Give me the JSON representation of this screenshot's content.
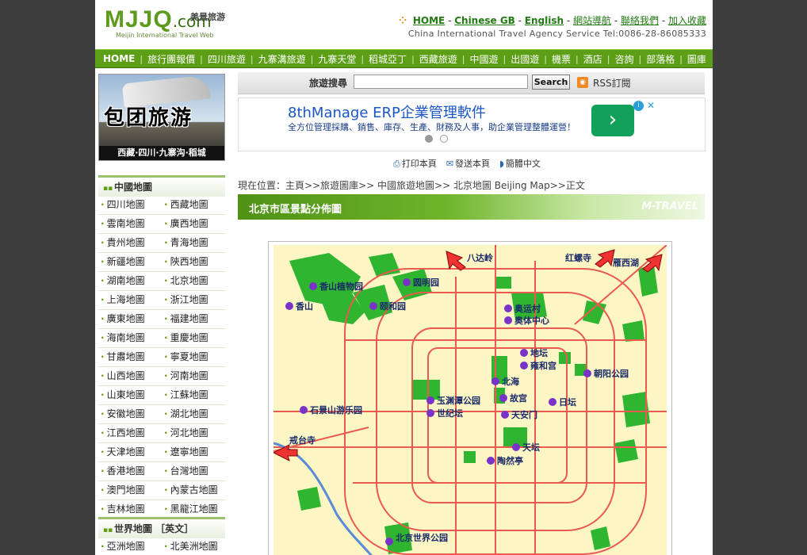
{
  "header": {
    "logo_main": "MJJQ",
    "logo_com": ".com",
    "logo_cn": "美景旅游",
    "logo_en": "Meijin International Travel Web",
    "links": [
      "HOME",
      "Chinese GB",
      "English",
      "網站導航",
      "聯絡我們",
      "加入收藏"
    ],
    "agency": "China International Travel Agency Service Tel:0086-28-86085333"
  },
  "nav": [
    "HOME",
    "旅行團報價",
    "四川旅遊",
    "九寨溝旅遊",
    "九寨天堂",
    "稻城亞丁",
    "西藏旅遊",
    "中國遊",
    "出國遊",
    "機票",
    "酒店",
    "咨詢",
    "部落格",
    "圖庫"
  ],
  "sidebar": {
    "banner_big": "包团旅游",
    "banner_small": "西藏·四川·九寨沟·稻城",
    "china_maps_heading": "中國地圖",
    "china_maps": [
      [
        "四川地圖",
        "西藏地圖"
      ],
      [
        "雲南地圖",
        "廣西地圖"
      ],
      [
        "貴州地圖",
        "青海地圖"
      ],
      [
        "新疆地圖",
        "陝西地圖"
      ],
      [
        "湖南地圖",
        "北京地圖"
      ],
      [
        "上海地圖",
        "浙江地圖"
      ],
      [
        "廣東地圖",
        "福建地圖"
      ],
      [
        "海南地圖",
        "重慶地圖"
      ],
      [
        "甘肅地圖",
        "寧夏地圖"
      ],
      [
        "山西地圖",
        "河南地圖"
      ],
      [
        "山東地圖",
        "江蘇地圖"
      ],
      [
        "安徽地圖",
        "湖北地圖"
      ],
      [
        "江西地圖",
        "河北地圖"
      ],
      [
        "天津地圖",
        "遼寧地圖"
      ],
      [
        "香港地圖",
        "台灣地圖"
      ],
      [
        "澳門地圖",
        "內蒙古地圖"
      ],
      [
        "吉林地圖",
        "黑龍江地圖"
      ]
    ],
    "world_maps_heading": "世界地圖 ［英文］",
    "world_maps": [
      [
        "亞洲地圖",
        "北美洲地圖"
      ]
    ]
  },
  "search": {
    "label": "旅遊搜尋",
    "button": "Search",
    "rss": "RSS訂閱"
  },
  "ad": {
    "title": "8thManage ERP企業管理軟件",
    "subtitle": "全方位管理採購、銷售、庫存、生產、財務及人事，助企業管理整體運營！"
  },
  "tools": {
    "print": "打印本頁",
    "send": "發送本頁",
    "convert": "簡體中文"
  },
  "breadcrumb": "現在位置：主頁>>旅遊圖庫>> 中國旅遊地圖>> 北京地圖 Beijing Map>>正文",
  "title": {
    "text": "北京市區景點分佈圖",
    "watermark": "M-TRAVEL"
  },
  "map_labels": [
    "八达岭",
    "红螺寺",
    "雁西湖",
    "香山植物园",
    "圆明园",
    "香山",
    "颐和园",
    "奥运村",
    "奥体中心",
    "地坛",
    "雍和宫",
    "朝阳公园",
    "北海",
    "故宫",
    "日坛",
    "玉渊潭公园",
    "世纪坛",
    "天安门",
    "石景山游乐园",
    "戒台寺",
    "天坛",
    "陶然亭",
    "北京世界公园"
  ]
}
